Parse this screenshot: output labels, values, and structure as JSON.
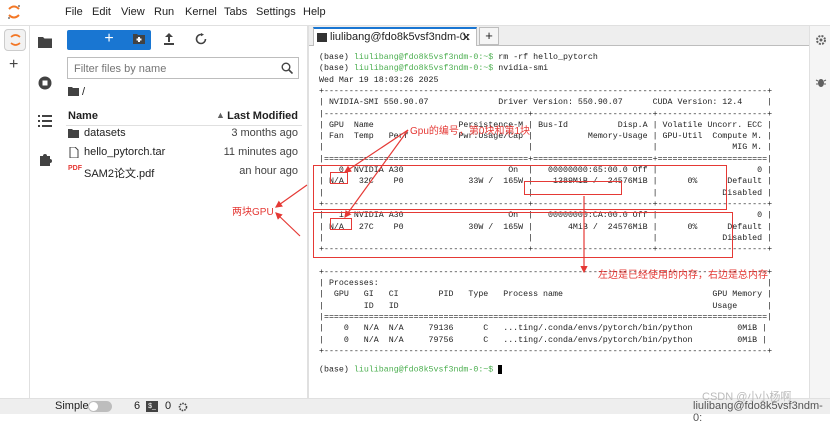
{
  "menubar": {
    "items": [
      "File",
      "Edit",
      "View",
      "Run",
      "Kernel",
      "Tabs",
      "Settings",
      "Help"
    ]
  },
  "filebrowser": {
    "new_label": "+",
    "filter_placeholder": "Filter files by name",
    "breadcrumb": "/",
    "col_name": "Name",
    "col_modified": "Last Modified",
    "files": [
      {
        "name": "datasets",
        "modified": "3 months ago",
        "icon": "folder-icon"
      },
      {
        "name": "hello_pytorch.tar",
        "modified": "11 minutes ago",
        "icon": "file-icon"
      },
      {
        "name": "SAM2论文.pdf",
        "modified": "an hour ago",
        "icon": "pdf-icon"
      }
    ]
  },
  "terminal": {
    "tab_label": "liulibang@fdo8k5vsf3ndm-0:",
    "prompt": "liulibang@fdo8k5vsf3ndm-0:~$",
    "lines": [
      {
        "pre": "(base) ",
        "prompt": "liulibang@fdo8k5vsf3ndm-0:~$",
        "cmd": " rm -rf hello_pytorch"
      },
      {
        "pre": "(base) ",
        "prompt": "liulibang@fdo8k5vsf3ndm-0:~$",
        "cmd": " nvidia-smi"
      },
      {
        "text": "Wed Mar 19 18:03:26 2025"
      },
      {
        "text": "+-----------------------------------------------------------------------------------------+"
      },
      {
        "text": "| NVIDIA-SMI 550.90.07              Driver Version: 550.90.07      CUDA Version: 12.4     |"
      },
      {
        "text": "|-----------------------------------------+------------------------+----------------------+"
      },
      {
        "text": "| GPU  Name                 Persistence-M | Bus-Id          Disp.A | Volatile Uncorr. ECC |"
      },
      {
        "text": "| Fan  Temp   Perf          Pwr:Usage/Cap |           Memory-Usage | GPU-Util  Compute M. |"
      },
      {
        "text": "|                                         |                        |               MIG M. |"
      },
      {
        "text": "|=========================================+========================+======================|"
      },
      {
        "text": "|   0  NVIDIA A30                     On  |   00000000:65:00.0 Off |                    0 |"
      },
      {
        "text": "| N/A   32C    P0             33W /  165W |    1389MiB /  24576MiB |      0%      Default |"
      },
      {
        "text": "|                                         |                        |             Disabled |"
      },
      {
        "text": "+-----------------------------------------+------------------------+----------------------+"
      },
      {
        "text": "|   1  NVIDIA A30                     On  |   00000000:CA:00.0 Off |                    0 |"
      },
      {
        "text": "| N/A   27C    P0             30W /  165W |       4MiB /  24576MiB |      0%      Default |"
      },
      {
        "text": "|                                         |                        |             Disabled |"
      },
      {
        "text": "+-----------------------------------------+------------------------+----------------------+"
      },
      {
        "text": ""
      },
      {
        "text": "+-----------------------------------------------------------------------------------------+"
      },
      {
        "text": "| Processes:                                                                              |"
      },
      {
        "text": "|  GPU   GI   CI        PID   Type   Process name                              GPU Memory |"
      },
      {
        "text": "|        ID   ID                                                               Usage      |"
      },
      {
        "text": "|=========================================================================================|"
      },
      {
        "text": "|    0   N/A  N/A     79136      C   ...ting/.conda/envs/pytorch/bin/python         0MiB |"
      },
      {
        "text": "|    0   N/A  N/A     79756      C   ...ting/.conda/envs/pytorch/bin/python         0MiB |"
      },
      {
        "text": "+-----------------------------------------------------------------------------------------+"
      }
    ],
    "last_pre": "(base) "
  },
  "annotations": {
    "gpu_id": "Gpu的编号，第0块和第1块",
    "two_gpu": "两块GPU",
    "memory": "左边是已经使用的内存，右边是总内存"
  },
  "statusbar": {
    "mode": "Simple",
    "count1": "6",
    "count2": "0",
    "right": "liulibang@fdo8k5vsf3ndm-0:"
  },
  "watermark": "CSDN @小小杨啊",
  "colors": {
    "accent": "#1976d2",
    "annotation": "#e53935",
    "prompt": "#4caf50"
  }
}
